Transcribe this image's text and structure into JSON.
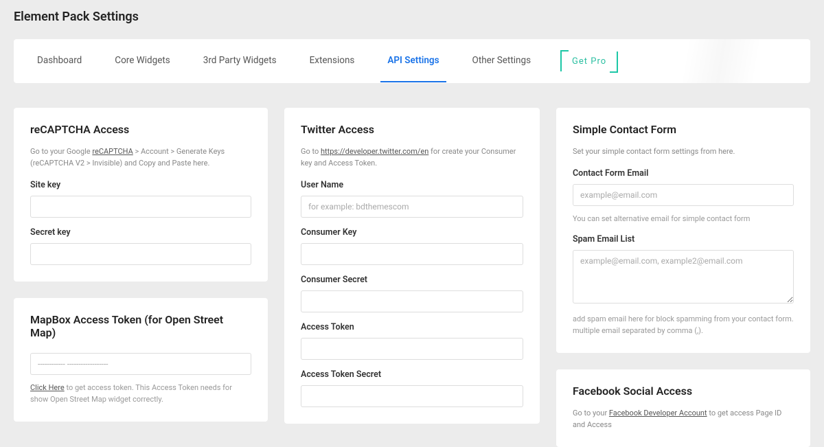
{
  "page": {
    "title": "Element Pack Settings"
  },
  "tabs": [
    {
      "label": "Dashboard"
    },
    {
      "label": "Core Widgets"
    },
    {
      "label": "3rd Party Widgets"
    },
    {
      "label": "Extensions"
    },
    {
      "label": "API Settings"
    },
    {
      "label": "Other Settings"
    },
    {
      "label": "Get Pro"
    }
  ],
  "recaptcha": {
    "heading": "reCAPTCHA Access",
    "desc_pre": "Go to your Google ",
    "link_text": "reCAPTCHA",
    "desc_post": " > Account > Generate Keys (reCAPTCHA V2 > Invisible) and Copy and Paste here.",
    "site_key_label": "Site key",
    "secret_key_label": "Secret key"
  },
  "mapbox": {
    "heading": "MapBox Access Token (for Open Street Map)",
    "placeholder": "------------ ------------------",
    "link_text": "Click Here",
    "hint_post": " to get access token. This Access Token needs for show Open Street Map widget correctly."
  },
  "twitter": {
    "heading": "Twitter Access",
    "desc_pre": "Go to ",
    "link_text": "https://developer.twitter.com/en",
    "desc_post": " for create your Consumer key and Access Token.",
    "username_label": "User Name",
    "username_placeholder": "for example: bdthemescom",
    "consumer_key_label": "Consumer Key",
    "consumer_secret_label": "Consumer Secret",
    "access_token_label": "Access Token",
    "access_token_secret_label": "Access Token Secret"
  },
  "contact": {
    "heading": "Simple Contact Form",
    "desc": "Set your simple contact form settings from here.",
    "email_label": "Contact Form Email",
    "email_placeholder": "example@email.com",
    "email_hint": "You can set alternative email for simple contact form",
    "spam_label": "Spam Email List",
    "spam_placeholder": "example@email.com, example2@email.com",
    "spam_hint": "add spam email here for block spamming from your contact form. multiple email separated by comma (,)."
  },
  "facebook": {
    "heading": "Facebook Social Access",
    "desc_pre": "Go to your ",
    "link_text": "Facebook Developer Account",
    "desc_post": " to get access Page ID and Access"
  }
}
